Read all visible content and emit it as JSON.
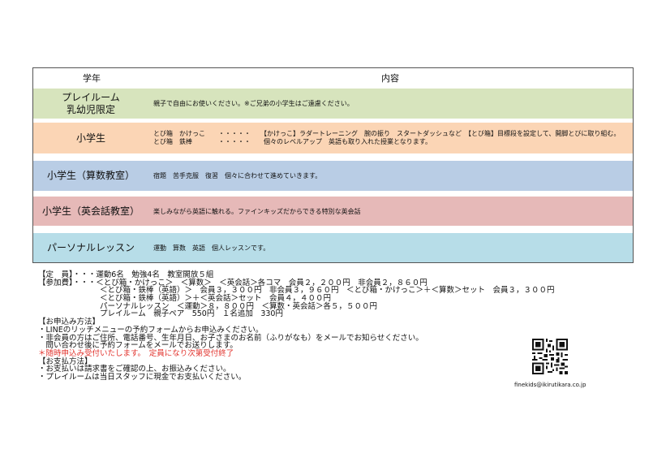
{
  "table": {
    "header": {
      "grade": "学年",
      "content": "内容"
    },
    "rows": [
      {
        "label_lines": [
          "プレイルーム",
          "乳幼児限定"
        ],
        "content_lines": [
          "親子で自由にお使いください。※ご兄弟の小学生はご遠慮ください。"
        ]
      },
      {
        "label_lines": [
          "小学生"
        ],
        "content_lines": [
          "とび箱　かけっこ　　・・・・・　　【かけっこ】ラダートレーニング　腕の振り　スタートダッシュなど　【とび箱】目標段を設定して、開脚とびに取り組む。",
          "とび箱　鉄棒　　　　・・・・・　　個々のレベルアップ　英語も取り入れた授業となります。"
        ]
      },
      {
        "label_lines": [
          "小学生（算数教室）"
        ],
        "content_lines": [
          "宿題　苦手克服　復習　個々に合わせて進めていきます。"
        ]
      },
      {
        "label_lines": [
          "小学生（英会話教室）"
        ],
        "content_lines": [
          "楽しみながら英語に触れる。ファインキッズだからできる特別な英会話"
        ]
      },
      {
        "label_lines": [
          "パーソナルレッスン"
        ],
        "content_lines": [
          "運動　算数　英語　個人レッスンです。"
        ]
      }
    ]
  },
  "notes": [
    {
      "text": "【定　員】・・・運動6名　勉強4名　教室開放５組",
      "red": false
    },
    {
      "text": "【参加費】・・・＜とび箱・かけっこ＞　＜算数＞　＜英会話＞各コマ　会員２，２００円　非会員２，８６０円",
      "red": false
    },
    {
      "text": "　　　　　　　　＜とび箱・鉄棒（英語）＞　会員３，３００円　非会員３，９６０円　＜とび箱・かけっこ＞＋＜算数＞セット　会員３，３００円",
      "red": false
    },
    {
      "text": "　　　　　　　　＜とび箱・鉄棒（英語）＞＋＜英会話＞セット　会員４，４００円",
      "red": false
    },
    {
      "text": "　　　　　　　　パーソナルレッスン　＜運動＞８，８００円　＜算数・英会話＞各５，５００円",
      "red": false
    },
    {
      "text": "　　　　　　　　プレイルーム　親子ペア　550円　１名追加　330円",
      "red": false
    },
    {
      "text": "【お申込み方法】",
      "red": false
    },
    {
      "text": "・LINEのリッチメニューの予約フォームからお申込みください。",
      "red": false
    },
    {
      "text": "・非会員の方はご住所、電話番号、生年月日、お子さまのお名前（ふりがなも）をメールでお知らせください。",
      "red": false
    },
    {
      "text": "　問い合わせ後に予約フォームをメールでお送りします。",
      "red": false
    },
    {
      "text": "＊随時申込み受付いたします。　定員になり次第受付終了",
      "red": true
    },
    {
      "text": "【お支払方法】",
      "red": false
    },
    {
      "text": "・お支払いは請求書をご確認の上、お振込みください。",
      "red": false
    },
    {
      "text": "・プレイルームは当日スタッフに現金でお支払いください。",
      "red": false
    }
  ],
  "contact": {
    "email": "finekids@ikirutikara.co.jp",
    "qr_icon": "qr-code-icon"
  }
}
